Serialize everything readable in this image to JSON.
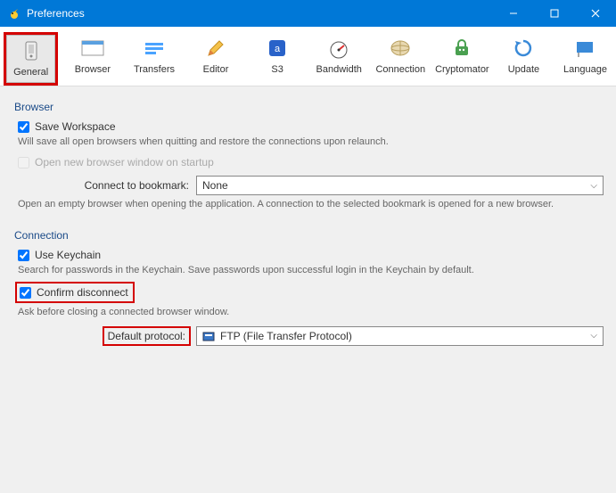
{
  "window": {
    "title": "Preferences"
  },
  "toolbar": {
    "items": [
      {
        "label": "General"
      },
      {
        "label": "Browser"
      },
      {
        "label": "Transfers"
      },
      {
        "label": "Editor"
      },
      {
        "label": "S3"
      },
      {
        "label": "Bandwidth"
      },
      {
        "label": "Connection"
      },
      {
        "label": "Cryptomator"
      },
      {
        "label": "Update"
      },
      {
        "label": "Language"
      }
    ]
  },
  "browser_group": {
    "title": "Browser",
    "save_workspace": {
      "label": "Save Workspace",
      "desc": "Will save all open browsers when quitting and restore the connections upon relaunch."
    },
    "open_new": {
      "label": "Open new browser window on startup"
    },
    "connect_bookmark": {
      "label": "Connect to bookmark:",
      "value": "None",
      "desc": "Open an empty browser when opening the application. A connection to the selected bookmark is opened for a new browser."
    }
  },
  "connection_group": {
    "title": "Connection",
    "use_keychain": {
      "label": "Use Keychain",
      "desc": "Search for passwords in the Keychain. Save passwords upon successful login in the Keychain by default."
    },
    "confirm_disconnect": {
      "label": "Confirm disconnect",
      "desc": "Ask before closing a connected browser window."
    },
    "default_protocol": {
      "label": "Default protocol:",
      "value": "FTP (File Transfer Protocol)"
    }
  }
}
